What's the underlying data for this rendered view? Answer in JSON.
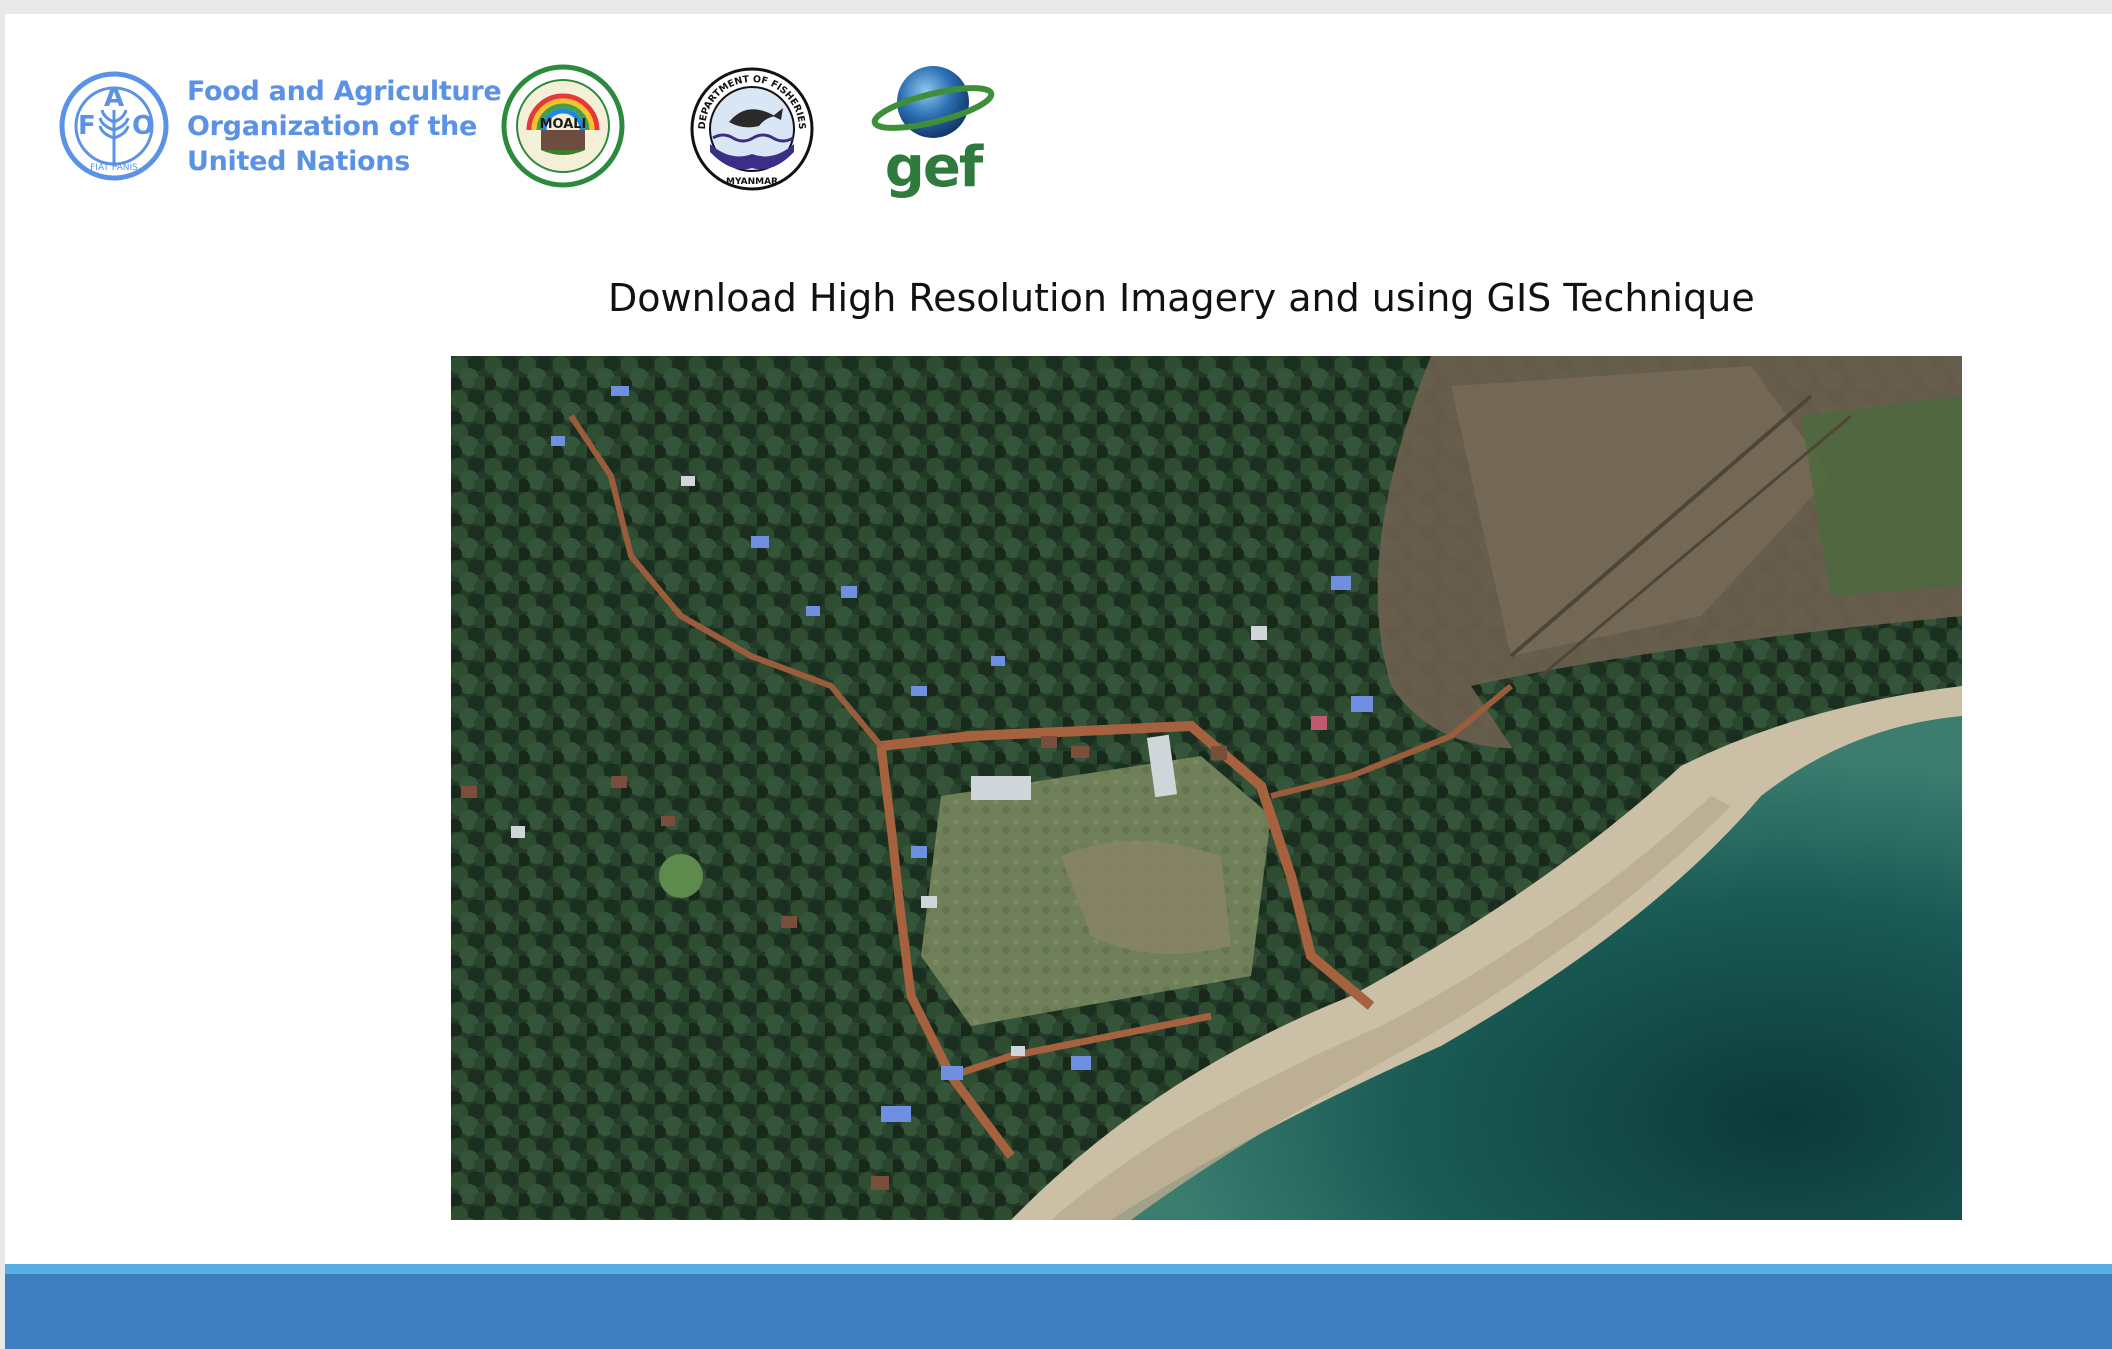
{
  "header": {
    "fao": {
      "emblem_letters": [
        "F",
        "A",
        "O"
      ],
      "emblem_motto": "FIAT PANIS",
      "name_lines": [
        "Food and Agriculture",
        "Organization of the",
        "United Nations"
      ]
    },
    "moali": {
      "label": "MOALI"
    },
    "fisheries": {
      "top_text": "DEPARTMENT OF FISHERIES",
      "bottom_text": "MYANMAR"
    },
    "gef": {
      "label": "gef"
    }
  },
  "slide": {
    "title": "Download High Resolution Imagery and using GIS Technique"
  },
  "colors": {
    "fao_blue": "#5b92e5",
    "footer_blue": "#3d7fc1",
    "footer_light_blue": "#5aaee6",
    "gef_green": "#2f7a3d"
  },
  "icons": {
    "satellite_image": "satellite-imagery"
  }
}
